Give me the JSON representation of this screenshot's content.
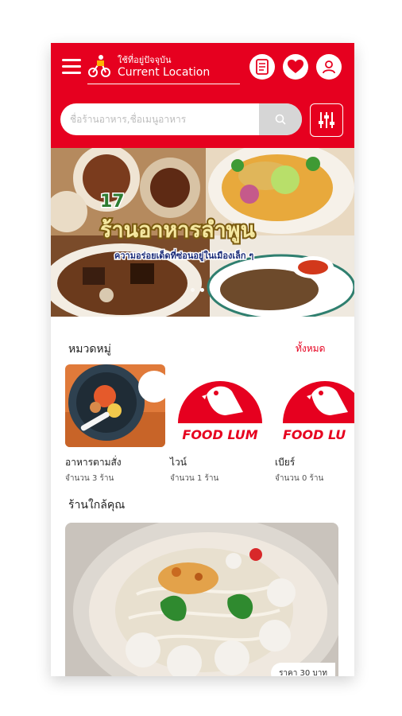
{
  "header": {
    "location_hint": "ใช้ที่อยู่ปัจจุบัน",
    "location_label": "Current Location"
  },
  "search": {
    "placeholder": "ชื่อร้านอาหาร,ชื่อเมนูอาหาร"
  },
  "banner": {
    "number": "17",
    "headline": "ร้านอาหารลำพูน",
    "subtitle": "ความอร่อยเด็ดที่ซ่อนอยู่ในเมืองเล็ก ๆ"
  },
  "categories": {
    "title": "หมวดหมู่",
    "see_all": "ทั้งหมด",
    "items": [
      {
        "name": "อาหารตามสั่ง",
        "count": "จำนวน 3 ร้าน"
      },
      {
        "name": "ไวน์",
        "count": "จำนวน 1 ร้าน",
        "logo_text": "FOOD LUM"
      },
      {
        "name": "เบียร์",
        "count": "จำนวน 0 ร้าน",
        "logo_text": "FOOD LU"
      }
    ]
  },
  "nearby": {
    "title": "ร้านใกล้คุณ",
    "price": "ราคา 30 บาท"
  },
  "colors": {
    "brand_red": "#e6001f",
    "search_button": "#d6d6d6"
  },
  "icons": [
    "menu-icon",
    "delivery-rider-icon",
    "document-icon",
    "heart-icon",
    "user-icon",
    "search-icon",
    "filter-sliders-icon"
  ]
}
